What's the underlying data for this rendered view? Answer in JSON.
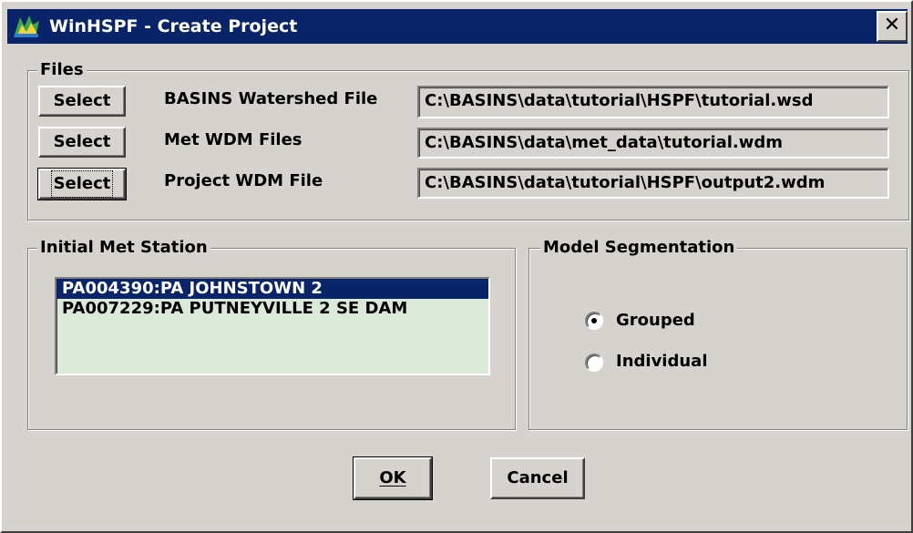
{
  "window": {
    "title": "WinHSPF - Create Project",
    "close_label": "✕"
  },
  "files": {
    "group_label": "Files",
    "rows": [
      {
        "button_label": "Select",
        "label": "BASINS Watershed File",
        "value": "C:\\BASINS\\data\\tutorial\\HSPF\\tutorial.wsd"
      },
      {
        "button_label": "Select",
        "label": "Met WDM Files",
        "value": "C:\\BASINS\\data\\met_data\\tutorial.wdm"
      },
      {
        "button_label": "Select",
        "label": "Project WDM File",
        "value": "C:\\BASINS\\data\\tutorial\\HSPF\\output2.wdm"
      }
    ]
  },
  "met_station": {
    "group_label": "Initial Met Station",
    "items": [
      {
        "label": "PA004390:PA JOHNSTOWN 2",
        "selected": true
      },
      {
        "label": "PA007229:PA PUTNEYVILLE 2 SE DAM",
        "selected": false
      }
    ]
  },
  "segmentation": {
    "group_label": "Model Segmentation",
    "options": [
      {
        "label": "Grouped",
        "checked": true
      },
      {
        "label": "Individual",
        "checked": false
      }
    ]
  },
  "buttons": {
    "ok_label": "OK",
    "cancel_label": "Cancel"
  },
  "colors": {
    "titlebar": "#0a246a",
    "dialog_face": "#d6d3ce",
    "list_background": "#dbe9d8",
    "selection": "#0a246a"
  }
}
